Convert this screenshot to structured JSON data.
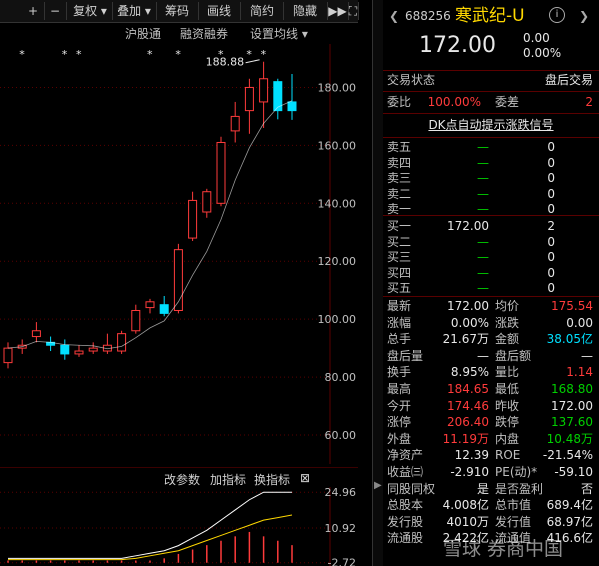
{
  "toolbar": {
    "items": [
      "+",
      "−",
      "复权 ▾",
      "叠加 ▾",
      "筹码",
      "画线",
      "简约",
      "隐藏",
      "▶▶",
      "⛶"
    ]
  },
  "subbar": {
    "items": [
      "沪股通",
      "融资融券",
      "设置均线 ▾"
    ],
    "stars": [
      "*",
      "* *",
      "*",
      "*",
      "* *"
    ]
  },
  "chart": {
    "y_ticks": [
      "180.00",
      "160.00",
      "140.00",
      "120.00",
      "100.00",
      "80.00",
      "60.00"
    ],
    "high_label": "188.88",
    "colors": {
      "up": "#ff3b3b",
      "down": "#00e0ff",
      "ma": "#ffffff",
      "grid": "#5a0000"
    }
  },
  "chart_data": {
    "type": "candlestick",
    "ylim": [
      50,
      195
    ],
    "candles": [
      {
        "o": 85,
        "h": 92,
        "l": 83,
        "c": 90
      },
      {
        "o": 90,
        "h": 93,
        "l": 88,
        "c": 91
      },
      {
        "o": 94,
        "h": 99,
        "l": 92,
        "c": 96
      },
      {
        "o": 92,
        "h": 94,
        "l": 89,
        "c": 91
      },
      {
        "o": 91,
        "h": 93,
        "l": 86,
        "c": 88
      },
      {
        "o": 88,
        "h": 91,
        "l": 87,
        "c": 89
      },
      {
        "o": 89,
        "h": 92,
        "l": 88,
        "c": 90
      },
      {
        "o": 89,
        "h": 95,
        "l": 88,
        "c": 91
      },
      {
        "o": 89,
        "h": 96,
        "l": 88,
        "c": 95
      },
      {
        "o": 96,
        "h": 105,
        "l": 95,
        "c": 103
      },
      {
        "o": 104,
        "h": 107,
        "l": 102,
        "c": 106
      },
      {
        "o": 105,
        "h": 108,
        "l": 101,
        "c": 102
      },
      {
        "o": 103,
        "h": 126,
        "l": 102,
        "c": 124
      },
      {
        "o": 128,
        "h": 144,
        "l": 127,
        "c": 141
      },
      {
        "o": 137,
        "h": 145,
        "l": 135,
        "c": 144
      },
      {
        "o": 140,
        "h": 163,
        "l": 139,
        "c": 161
      },
      {
        "o": 165,
        "h": 175,
        "l": 161,
        "c": 170
      },
      {
        "o": 172,
        "h": 183,
        "l": 164,
        "c": 180
      },
      {
        "o": 175,
        "h": 188.88,
        "l": 166,
        "c": 183
      },
      {
        "o": 182,
        "h": 183,
        "l": 169,
        "c": 172
      },
      {
        "o": 175,
        "h": 184.65,
        "l": 168.8,
        "c": 172
      }
    ],
    "indicator": {
      "y_ticks": [
        "24.96",
        "10.92",
        "-2.72"
      ],
      "bars": [
        1,
        1,
        1,
        1,
        1,
        1,
        1,
        1,
        1,
        1,
        1,
        2,
        4,
        6,
        8,
        10,
        12,
        14,
        12,
        10,
        8
      ],
      "line1": [
        -1,
        -1,
        -1,
        -1,
        -1,
        -1,
        -1,
        -1,
        -1,
        0,
        1,
        2,
        4,
        7,
        10,
        14,
        18,
        22,
        24.96,
        24.96,
        24.96
      ],
      "line2": [
        -1.5,
        -1.5,
        -1.5,
        -1.5,
        -1.5,
        -1.5,
        -1.5,
        -1.5,
        -1.5,
        -1,
        0,
        1,
        2,
        4,
        6,
        8,
        10,
        12,
        14,
        15,
        16
      ]
    }
  },
  "indicator_bar": {
    "items": [
      "改参数",
      "加指标",
      "换指标",
      "⊠"
    ]
  },
  "quote": {
    "code": "688256",
    "name": "寒武纪-U",
    "price": "172.00",
    "change": "0.00",
    "change_pct": "0.00%",
    "trade_status_label": "交易状态",
    "trade_status_value": "盘后交易",
    "weibi_label": "委比",
    "weibi_value": "100.00%",
    "weicha_label": "委差",
    "weicha_value": "2",
    "dk_link": "DK点自动提示涨跌信号",
    "asks": [
      {
        "label": "卖五",
        "price": "—",
        "vol": "0"
      },
      {
        "label": "卖四",
        "price": "—",
        "vol": "0"
      },
      {
        "label": "卖三",
        "price": "—",
        "vol": "0"
      },
      {
        "label": "卖二",
        "price": "—",
        "vol": "0"
      },
      {
        "label": "卖一",
        "price": "—",
        "vol": "0"
      }
    ],
    "bids": [
      {
        "label": "买一",
        "price": "172.00",
        "vol": "2"
      },
      {
        "label": "买二",
        "price": "—",
        "vol": "0"
      },
      {
        "label": "买三",
        "price": "—",
        "vol": "0"
      },
      {
        "label": "买四",
        "price": "—",
        "vol": "0"
      },
      {
        "label": "买五",
        "price": "—",
        "vol": "0"
      }
    ],
    "stats": [
      {
        "l1": "最新",
        "v1": "172.00",
        "c1": "white",
        "l2": "均价",
        "v2": "175.54",
        "c2": "red"
      },
      {
        "l1": "涨幅",
        "v1": "0.00%",
        "c1": "white",
        "l2": "涨跌",
        "v2": "0.00",
        "c2": "white"
      },
      {
        "l1": "总手",
        "v1": "21.67万",
        "c1": "white",
        "l2": "金额",
        "v2": "38.05亿",
        "c2": "cyan"
      },
      {
        "l1": "盘后量",
        "v1": "—",
        "c1": "white",
        "l2": "盘后额",
        "v2": "—",
        "c2": "white"
      },
      {
        "l1": "换手",
        "v1": "8.95%",
        "c1": "white",
        "l2": "量比",
        "v2": "1.14",
        "c2": "red"
      },
      {
        "l1": "最高",
        "v1": "184.65",
        "c1": "red",
        "l2": "最低",
        "v2": "168.80",
        "c2": "green"
      },
      {
        "l1": "今开",
        "v1": "174.46",
        "c1": "red",
        "l2": "昨收",
        "v2": "172.00",
        "c2": "white"
      },
      {
        "l1": "涨停",
        "v1": "206.40",
        "c1": "red",
        "l2": "跌停",
        "v2": "137.60",
        "c2": "green"
      },
      {
        "l1": "外盘",
        "v1": "11.19万",
        "c1": "red",
        "l2": "内盘",
        "v2": "10.48万",
        "c2": "green"
      },
      {
        "l1": "净资产",
        "v1": "12.39",
        "c1": "white",
        "l2": "ROE",
        "v2": "-21.54%",
        "c2": "white"
      },
      {
        "l1": "收益㈢",
        "v1": "-2.910",
        "c1": "white",
        "l2": "PE(动)*",
        "v2": "-59.10",
        "c2": "white"
      },
      {
        "l1": "同股同权",
        "v1": "是",
        "c1": "white",
        "l2": "是否盈利",
        "v2": "否",
        "c2": "white"
      },
      {
        "l1": "总股本",
        "v1": "4.008亿",
        "c1": "white",
        "l2": "总市值",
        "v2": "689.4亿",
        "c2": "white"
      },
      {
        "l1": "发行股",
        "v1": "4010万",
        "c1": "white",
        "l2": "发行值",
        "v2": "68.97亿",
        "c2": "white"
      },
      {
        "l1": "流通股",
        "v1": "2.422亿",
        "c1": "white",
        "l2": "流通值",
        "v2": "416.6亿",
        "c2": "white"
      }
    ],
    "watermark": "雪球 券商中国"
  }
}
